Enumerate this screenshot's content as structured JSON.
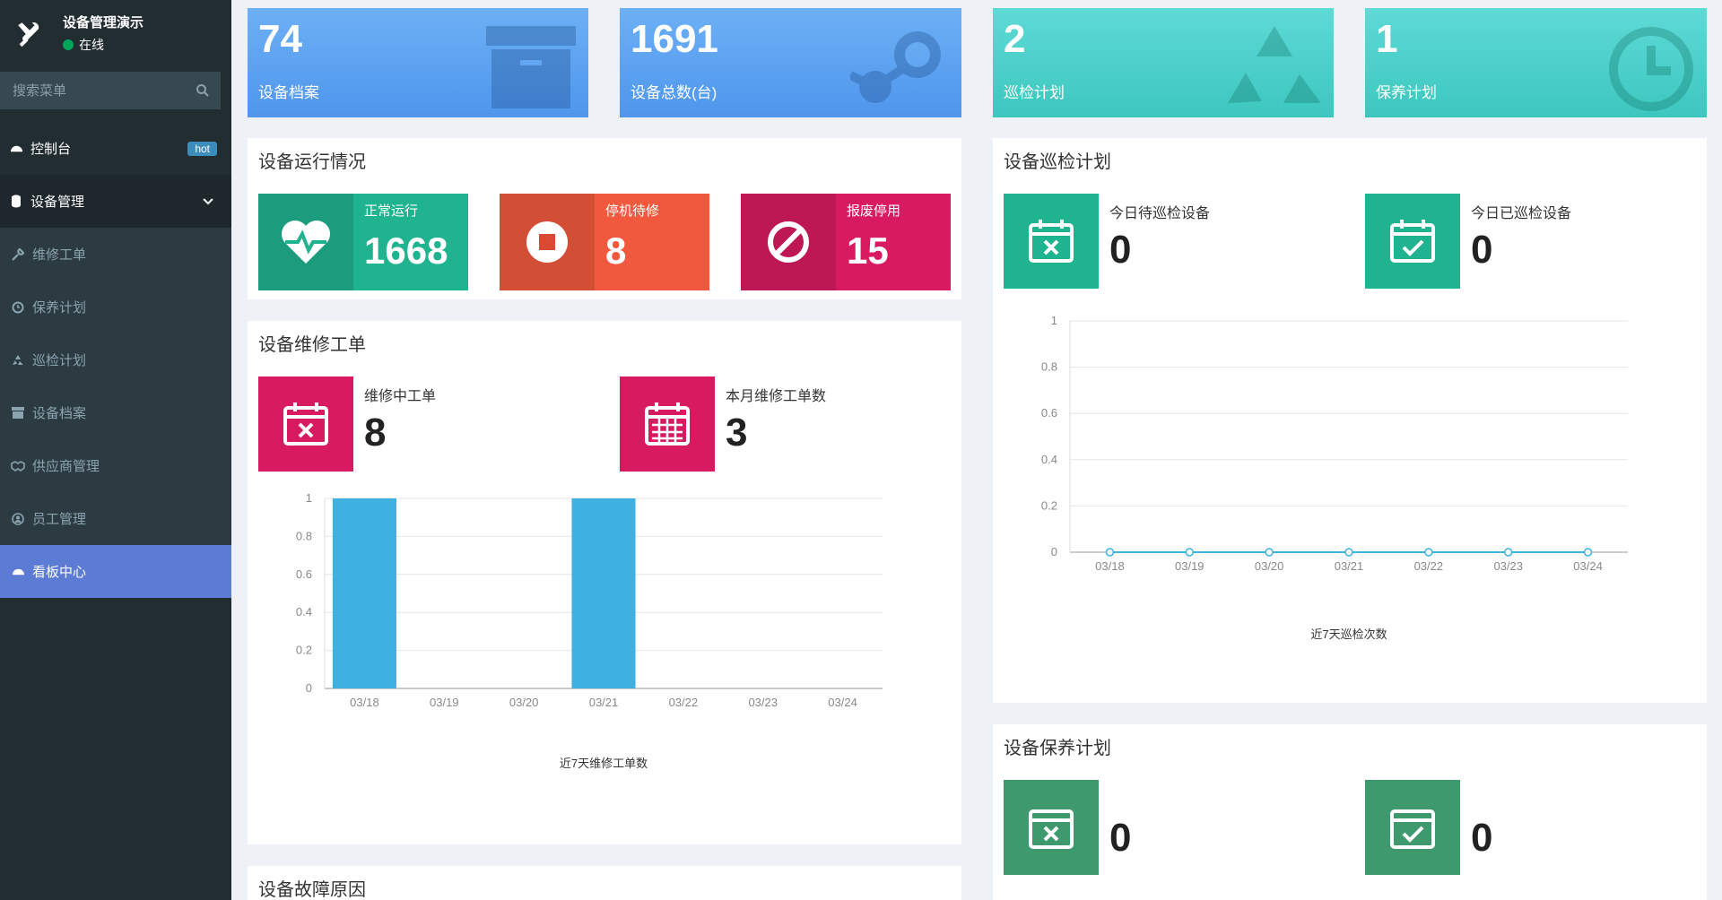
{
  "sidebar": {
    "app_name": "设备管理演示",
    "status": "在线",
    "search_placeholder": "搜索菜单",
    "items": [
      {
        "label": "控制台",
        "badge": "hot"
      },
      {
        "label": "设备管理"
      },
      {
        "label": "维修工单"
      },
      {
        "label": "保养计划"
      },
      {
        "label": "巡检计划"
      },
      {
        "label": "设备档案"
      },
      {
        "label": "供应商管理"
      },
      {
        "label": "员工管理"
      },
      {
        "label": "看板中心"
      }
    ]
  },
  "stats": [
    {
      "value": "74",
      "label": "设备档案"
    },
    {
      "value": "1691",
      "label": "设备总数(台)"
    },
    {
      "value": "2",
      "label": "巡检计划"
    },
    {
      "value": "1",
      "label": "保养计划"
    }
  ],
  "running": {
    "title": "设备运行情况",
    "cards": [
      {
        "label": "正常运行",
        "value": "1668"
      },
      {
        "label": "停机待修",
        "value": "8"
      },
      {
        "label": "报废停用",
        "value": "15"
      }
    ]
  },
  "repair": {
    "title": "设备维修工单",
    "cards": [
      {
        "label": "维修中工单",
        "value": "8"
      },
      {
        "label": "本月维修工单数",
        "value": "3"
      }
    ]
  },
  "inspection": {
    "title": "设备巡检计划",
    "cards": [
      {
        "label": "今日待巡检设备",
        "value": "0"
      },
      {
        "label": "今日已巡检设备",
        "value": "0"
      }
    ]
  },
  "maintenance": {
    "title": "设备保养计划",
    "cards": [
      {
        "value": "0"
      },
      {
        "value": "0"
      }
    ]
  },
  "fault": {
    "title": "设备故障原因"
  },
  "colors": {
    "sidebar_bg": "#222d32",
    "active_menu": "#5b7bd5",
    "blue_card": "#5ea6f2",
    "teal_card": "#45cfc6",
    "green": "#1fb38f",
    "red": "#e25c43",
    "crimson": "#d81b60",
    "bar": "#3eb1e0"
  },
  "chart_data": [
    {
      "type": "bar",
      "categories": [
        "03/18",
        "03/19",
        "03/20",
        "03/21",
        "03/22",
        "03/23",
        "03/24"
      ],
      "values": [
        1,
        0,
        0,
        1,
        0,
        0,
        0
      ],
      "xlabel": "近7天维修工单数",
      "ylim": [
        0,
        1
      ],
      "yticks": [
        "0",
        "0.2",
        "0.4",
        "0.6",
        "0.8",
        "1"
      ]
    },
    {
      "type": "line",
      "categories": [
        "03/18",
        "03/19",
        "03/20",
        "03/21",
        "03/22",
        "03/23",
        "03/24"
      ],
      "values": [
        0,
        0,
        0,
        0,
        0,
        0,
        0
      ],
      "xlabel": "近7天巡检次数",
      "ylim": [
        0,
        1
      ],
      "yticks": [
        "0",
        "0.2",
        "0.4",
        "0.6",
        "0.8",
        "1"
      ]
    }
  ]
}
